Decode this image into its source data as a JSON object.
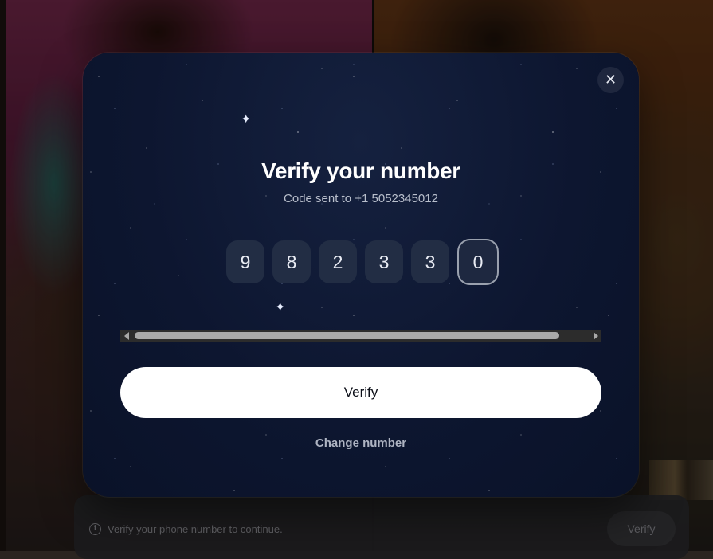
{
  "background": {
    "bottom_bar": {
      "info_icon": "info-icon",
      "message": "Verify your phone number to continue.",
      "verify_label": "Verify"
    }
  },
  "modal": {
    "close_icon": "close-icon",
    "close_glyph": "✕",
    "title": "Verify your number",
    "subtitle": "Code sent to +1 5052345012",
    "code_digits": [
      "9",
      "8",
      "2",
      "3",
      "3",
      "0"
    ],
    "active_digit_index": 5,
    "scrollbar": {
      "left_arrow": "scroll-left-arrow-icon",
      "right_arrow": "scroll-right-arrow-icon"
    },
    "verify_label": "Verify",
    "change_number_label": "Change number"
  },
  "colors": {
    "modal_bg": "#0d1630",
    "otp_box_bg": "#222d44",
    "active_border": "#9aa1ae",
    "primary_button_bg": "#ffffff",
    "primary_button_text": "#0c0f18"
  }
}
